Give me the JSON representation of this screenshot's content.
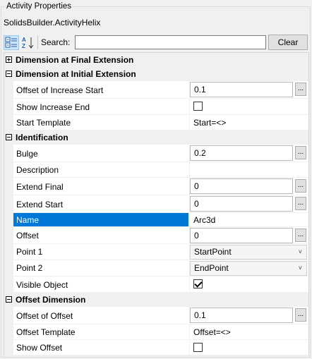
{
  "group_title": "Activity Properties",
  "component": "SolidsBuilder.ActivityHelix",
  "toolbar": {
    "search_label": "Search:",
    "search_value": "",
    "clear_label": "Clear"
  },
  "categories": {
    "final_extension": "Dimension at Final Extension",
    "initial_extension": "Dimension at Initial Extension",
    "identification": "Identification",
    "offset_dimension": "Offset Dimension"
  },
  "props": {
    "offset_increase_start": {
      "name": "Offset of Increase Start",
      "value": "0.1"
    },
    "show_increase_end": {
      "name": "Show Increase End",
      "checked": false
    },
    "start_template": {
      "name": "Start Template",
      "value": "Start=<>"
    },
    "bulge": {
      "name": "Bulge",
      "value": "0.2"
    },
    "description": {
      "name": "Description",
      "value": ""
    },
    "extend_final": {
      "name": "Extend Final",
      "value": "0"
    },
    "extend_start": {
      "name": "Extend Start",
      "value": "0"
    },
    "name": {
      "name": "Name",
      "value": "Arc3d"
    },
    "offset": {
      "name": "Offset",
      "value": "0"
    },
    "point1": {
      "name": "Point 1",
      "value": "StartPoint"
    },
    "point2": {
      "name": "Point 2",
      "value": "EndPoint"
    },
    "visible_object": {
      "name": "Visible Object",
      "checked": true
    },
    "offset_of_offset": {
      "name": "Offset of Offset",
      "value": "0.1"
    },
    "offset_template": {
      "name": "Offset Template",
      "value": "Offset=<>"
    },
    "show_offset": {
      "name": "Show Offset",
      "checked": false
    }
  },
  "ellipsis": "...",
  "chevron": "˅"
}
